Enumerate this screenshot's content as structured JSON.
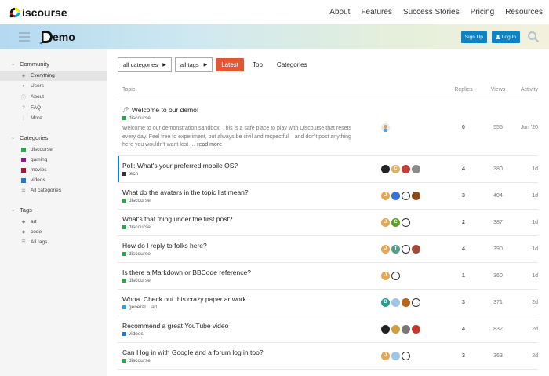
{
  "brand": {
    "name": "iscourse"
  },
  "top_nav": [
    "About",
    "Features",
    "Success Stories",
    "Pricing",
    "Resources"
  ],
  "demo": {
    "logo_text": "emo",
    "signup": "Sign Up",
    "login": "Log In"
  },
  "sidebar": {
    "community_label": "Community",
    "community_items": [
      {
        "label": "Everything",
        "icon": "layers-icon"
      },
      {
        "label": "Users",
        "icon": "users-icon"
      },
      {
        "label": "About",
        "icon": "info-icon"
      },
      {
        "label": "FAQ",
        "icon": "question-icon"
      },
      {
        "label": "More",
        "icon": "more-icon"
      }
    ],
    "categories_label": "Categories",
    "categories": [
      {
        "label": "discourse",
        "color": "#25aa4a"
      },
      {
        "label": "gaming",
        "color": "#8b1a8b"
      },
      {
        "label": "movies",
        "color": "#b3122e"
      },
      {
        "label": "videos",
        "color": "#1e7bd6"
      }
    ],
    "all_categories": "All categories",
    "tags_label": "Tags",
    "tags": [
      "art",
      "code"
    ],
    "all_tags": "All tags"
  },
  "filters": {
    "all_categories": "all categories",
    "all_tags": "all tags",
    "latest": "Latest",
    "top": "Top",
    "categories": "Categories"
  },
  "columns": {
    "topic": "Topic",
    "replies": "Replies",
    "views": "Views",
    "activity": "Activity"
  },
  "topics": [
    {
      "title": "Welcome to our demo!",
      "category": "discourse",
      "cat_color": "#25aa4a",
      "excerpt": "Welcome to our demonstration sandbox! This is a safe place to play with Discourse that resets every day. Feel free to experiment, but always be civil and respectful – and don't post anything here you wouldn't want lost …",
      "more": "read more",
      "replies": "0",
      "views": "555",
      "activity": "Jun '20"
    },
    {
      "title": "Poll: What's your preferred mobile OS?",
      "category": "tech",
      "cat_color": "#333333",
      "replies": "4",
      "views": "380",
      "activity": "1d"
    },
    {
      "title": "What do the avatars in the topic list mean?",
      "category": "discourse",
      "cat_color": "#25aa4a",
      "replies": "3",
      "views": "404",
      "activity": "1d"
    },
    {
      "title": "What's that thing under the first post?",
      "category": "discourse",
      "cat_color": "#25aa4a",
      "replies": "2",
      "views": "387",
      "activity": "1d"
    },
    {
      "title": "How do I reply to folks here?",
      "category": "discourse",
      "cat_color": "#25aa4a",
      "replies": "4",
      "views": "390",
      "activity": "1d"
    },
    {
      "title": "Is there a Markdown or BBCode reference?",
      "category": "discourse",
      "cat_color": "#25aa4a",
      "replies": "1",
      "views": "360",
      "activity": "1d"
    },
    {
      "title": "Whoa. Check out this crazy paper artwork",
      "category": "general",
      "cat_color": "#29a3d9",
      "tag": "art",
      "replies": "3",
      "views": "371",
      "activity": "2d"
    },
    {
      "title": "Recommend a great YouTube video",
      "category": "videos",
      "cat_color": "#1e7bd6",
      "replies": "4",
      "views": "832",
      "activity": "2d"
    },
    {
      "title": "Can I log in with Google and a forum log in too?",
      "category": "discourse",
      "cat_color": "#25aa4a",
      "replies": "3",
      "views": "363",
      "activity": "2d"
    }
  ],
  "avatar_letters": [
    "J",
    "C",
    "D",
    "T"
  ]
}
